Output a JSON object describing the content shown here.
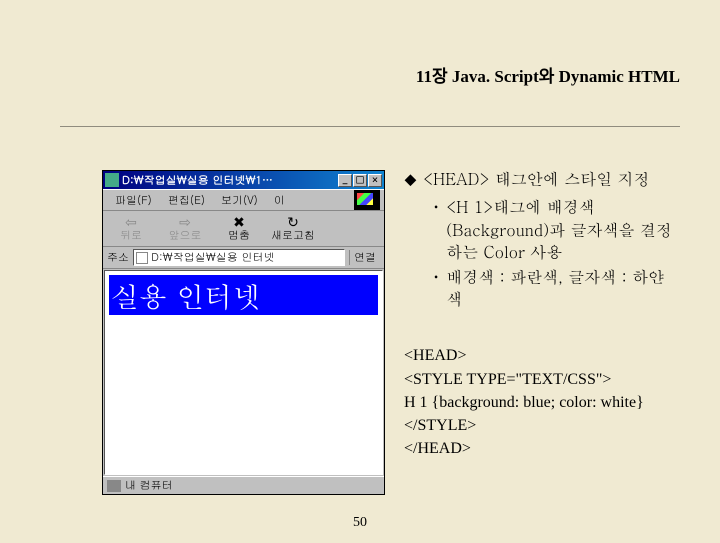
{
  "chapter_title": "11장 Java. Script와 Dynamic HTML",
  "browser": {
    "title": "D:\\작업실\\실용 인터넷\\1…",
    "menus": {
      "file": "파일(F)",
      "edit": "편집(E)",
      "view": "보기(V)",
      "more": "이"
    },
    "toolbar": {
      "back": "뒤로",
      "forward": "앞으로",
      "stop": "멈춤",
      "refresh": "새로고침"
    },
    "addr_label": "주소",
    "addr_value": "D:\\작업실\\실용 인터넷",
    "addr_go": "연결",
    "h1_text": "실용 인터넷",
    "status": "내 컴퓨터"
  },
  "bullets": {
    "main": "<HEAD> 태그안에 스타일 지정",
    "sub1": "<H 1>태그에 배경색(Background)과 글자색을 결정하는 Color 사용",
    "sub2": "배경색 : 파란색, 글자색 : 하얀색"
  },
  "code": {
    "l1": "<HEAD>",
    "l2": "<STYLE TYPE=\"TEXT/CSS\">",
    "l3": "H 1 {background: blue; color: white}",
    "l4": "</STYLE>",
    "l5": "</HEAD>"
  },
  "page_number": "50"
}
